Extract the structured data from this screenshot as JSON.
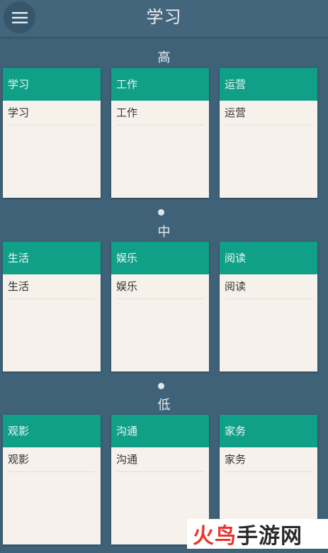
{
  "app": {
    "title": "学习",
    "menu_icon": "hamburger-menu-icon"
  },
  "sections": [
    {
      "label": "高",
      "cards": [
        {
          "header": "学习",
          "items": [
            "学习"
          ]
        },
        {
          "header": "工作",
          "items": [
            "工作"
          ]
        },
        {
          "header": "运营",
          "items": [
            "运营"
          ]
        }
      ]
    },
    {
      "label": "中",
      "cards": [
        {
          "header": "生活",
          "items": [
            "生活"
          ]
        },
        {
          "header": "娱乐",
          "items": [
            "娱乐"
          ]
        },
        {
          "header": "阅读",
          "items": [
            "阅读"
          ]
        }
      ]
    },
    {
      "label": "低",
      "cards": [
        {
          "header": "观影",
          "items": [
            "观影"
          ]
        },
        {
          "header": "沟通",
          "items": [
            "沟通"
          ]
        },
        {
          "header": "家务",
          "items": [
            "家务"
          ]
        }
      ]
    }
  ],
  "watermark": {
    "part1": "火鸟",
    "part2": "手游网"
  },
  "colors": {
    "background": "#3f6279",
    "card_header": "#10a088",
    "card_body": "#f6f1ea"
  }
}
